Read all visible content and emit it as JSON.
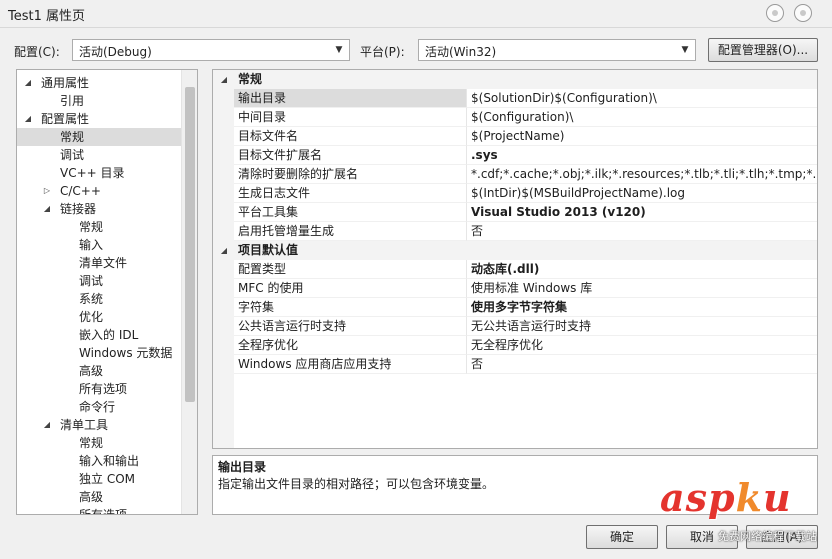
{
  "window": {
    "title": "Test1 属性页"
  },
  "toolbar": {
    "config_label": "配置(C):",
    "config_value": "活动(Debug)",
    "platform_label": "平台(P):",
    "platform_value": "活动(Win32)",
    "config_manager_label": "配置管理器(O)..."
  },
  "tree": {
    "items": [
      {
        "label": "通用属性",
        "twisty": "◢"
      },
      {
        "label": "引用",
        "twisty": ""
      },
      {
        "label": "配置属性",
        "twisty": "◢"
      },
      {
        "label": "常规",
        "twisty": ""
      },
      {
        "label": "调试",
        "twisty": ""
      },
      {
        "label": "VC++ 目录",
        "twisty": ""
      },
      {
        "label": "C/C++",
        "twisty": "▷"
      },
      {
        "label": "链接器",
        "twisty": "◢"
      },
      {
        "label": "常规",
        "twisty": ""
      },
      {
        "label": "输入",
        "twisty": ""
      },
      {
        "label": "清单文件",
        "twisty": ""
      },
      {
        "label": "调试",
        "twisty": ""
      },
      {
        "label": "系统",
        "twisty": ""
      },
      {
        "label": "优化",
        "twisty": ""
      },
      {
        "label": "嵌入的 IDL",
        "twisty": ""
      },
      {
        "label": "Windows 元数据",
        "twisty": ""
      },
      {
        "label": "高级",
        "twisty": ""
      },
      {
        "label": "所有选项",
        "twisty": ""
      },
      {
        "label": "命令行",
        "twisty": ""
      },
      {
        "label": "清单工具",
        "twisty": "◢"
      },
      {
        "label": "常规",
        "twisty": ""
      },
      {
        "label": "输入和输出",
        "twisty": ""
      },
      {
        "label": "独立 COM",
        "twisty": ""
      },
      {
        "label": "高级",
        "twisty": ""
      },
      {
        "label": "所有选项",
        "twisty": ""
      }
    ]
  },
  "grid": {
    "categories": [
      {
        "label": "常规",
        "twisty": "◢",
        "rows": [
          {
            "name": "输出目录",
            "value": "$(SolutionDir)$(Configuration)\\"
          },
          {
            "name": "中间目录",
            "value": "$(Configuration)\\"
          },
          {
            "name": "目标文件名",
            "value": "$(ProjectName)"
          },
          {
            "name": "目标文件扩展名",
            "value": ".sys"
          },
          {
            "name": "清除时要删除的扩展名",
            "value": "*.cdf;*.cache;*.obj;*.ilk;*.resources;*.tlb;*.tli;*.tlh;*.tmp;*.rsp;*.pgc;*."
          },
          {
            "name": "生成日志文件",
            "value": "$(IntDir)$(MSBuildProjectName).log"
          },
          {
            "name": "平台工具集",
            "value": "Visual Studio 2013 (v120)"
          },
          {
            "name": "启用托管增量生成",
            "value": "否"
          }
        ]
      },
      {
        "label": "项目默认值",
        "twisty": "◢",
        "rows": [
          {
            "name": "配置类型",
            "value": "动态库(.dll)"
          },
          {
            "name": "MFC 的使用",
            "value": "使用标准 Windows 库"
          },
          {
            "name": "字符集",
            "value": "使用多字节字符集"
          },
          {
            "name": "公共语言运行时支持",
            "value": "无公共语言运行时支持"
          },
          {
            "name": "全程序优化",
            "value": "无全程序优化"
          },
          {
            "name": "Windows 应用商店应用支持",
            "value": "否"
          }
        ]
      }
    ]
  },
  "description": {
    "title": "输出目录",
    "text": "指定输出文件目录的相对路径；可以包含环境变量。"
  },
  "buttons": {
    "ok_label": "确定",
    "cancel_label": "取消",
    "apply_label": "应用(A)"
  },
  "watermark": {
    "main": "asp",
    "dot": "k",
    "tail": "u",
    "sub": "免费网络编程下载站"
  }
}
